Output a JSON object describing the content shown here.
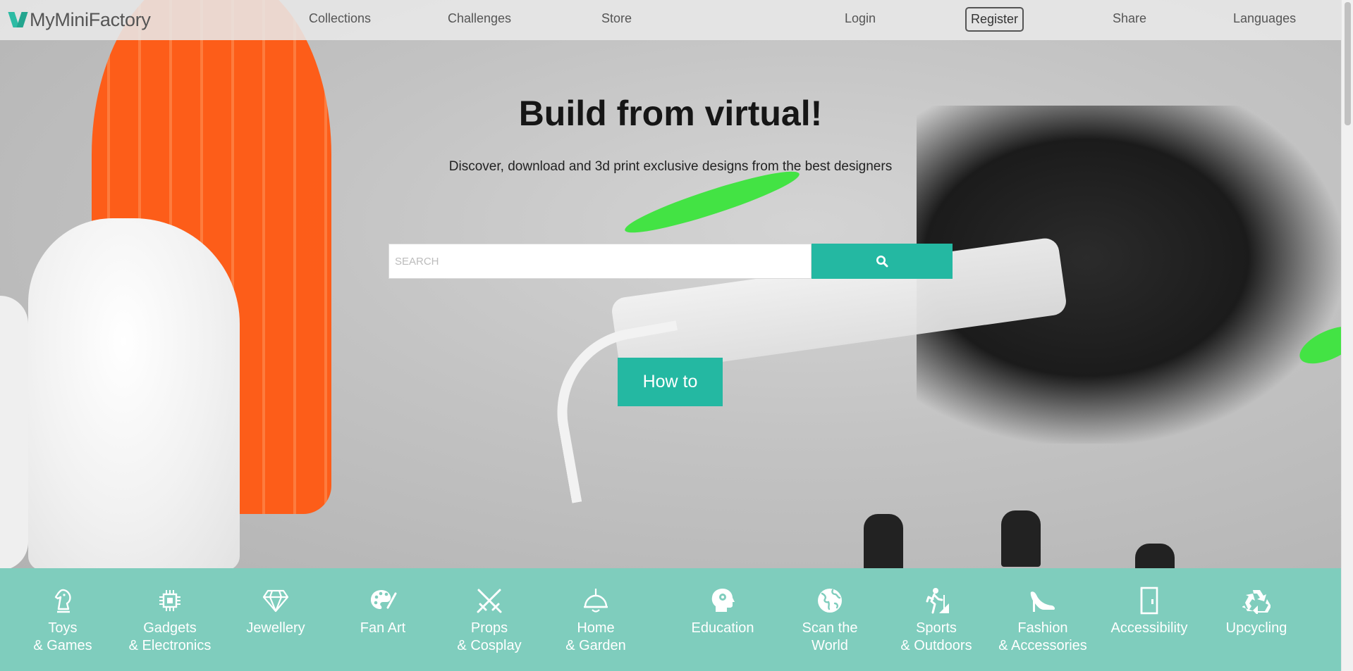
{
  "site": {
    "logo_text": "MyMiniFactory",
    "brand_color": "#24b8a2"
  },
  "nav": {
    "collections": "Collections",
    "challenges": "Challenges",
    "store": "Store",
    "login": "Login",
    "register": "Register",
    "share": "Share",
    "languages": "Languages"
  },
  "hero": {
    "title": "Build from virtual!",
    "subtitle": "Discover, download and 3d print exclusive designs from the best designers",
    "search_placeholder": "SEARCH",
    "search_icon": "search-icon",
    "howto_label": "How to"
  },
  "categories": [
    {
      "label": "Toys\n& Games",
      "icon": "chess-knight-icon"
    },
    {
      "label": "Gadgets\n& Electronics",
      "icon": "chip-icon"
    },
    {
      "label": "Jewellery",
      "icon": "diamond-icon"
    },
    {
      "label": "Fan Art",
      "icon": "palette-icon"
    },
    {
      "label": "Props\n& Cosplay",
      "icon": "crossed-swords-icon"
    },
    {
      "label": "Home\n& Garden",
      "icon": "lamp-icon"
    },
    {
      "label": "Education",
      "icon": "head-gear-icon"
    },
    {
      "label": "Scan the\nWorld",
      "icon": "globe-icon"
    },
    {
      "label": "Sports\n& Outdoors",
      "icon": "hiker-icon"
    },
    {
      "label": "Fashion\n& Accessories",
      "icon": "high-heel-icon"
    },
    {
      "label": "Accessibility",
      "icon": "door-icon"
    },
    {
      "label": "Upcycling",
      "icon": "recycle-icon"
    }
  ],
  "colors": {
    "category_band": "#7fcdbd",
    "topbar": "#e8e8e8"
  }
}
